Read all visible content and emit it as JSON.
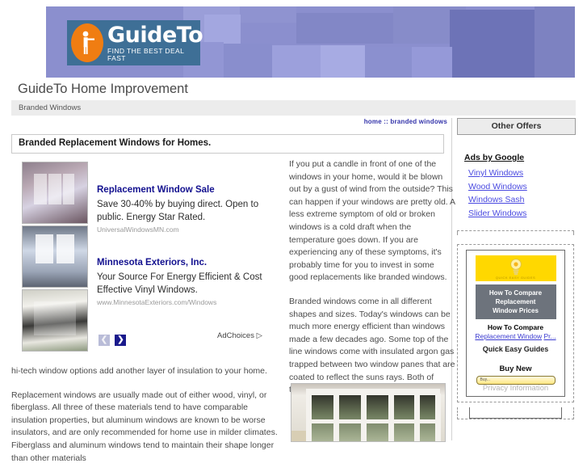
{
  "header": {
    "logo_name": "GuideTo",
    "logo_tagline": "FIND THE BEST DEAL FAST",
    "site_title": "GuideTo Home Improvement",
    "breadcrumb_bar": "Branded Windows",
    "top_nav": "home :: branded windows",
    "banner_color": "#8b8fce",
    "logo_box_color": "#3e6f96",
    "logo_circle_color": "#f07d12"
  },
  "main": {
    "page_title": "Branded Replacement Windows for Homes.",
    "ads": [
      {
        "title": "Replacement Window Sale",
        "description": "Save 30-40% by buying direct. Open to public. Energy Star Rated.",
        "url": "UniversalWindowsMN.com"
      },
      {
        "title": "Minnesota Exteriors, Inc.",
        "description": "Your Source For Energy Efficient & Cost Effective Vinyl Windows.",
        "url": "www.MinnesotaExteriors.com/Windows"
      }
    ],
    "ad_nav": {
      "prev": "❮",
      "next": "❯",
      "adchoices_label": "AdChoices"
    },
    "article_paragraphs": [
      "If you put a candle in front of one of the windows in your home, would it be blown out by a gust of wind from the outside? This can happen if your windows are pretty old. A less extreme symptom of old or broken windows is a cold draft when the temperature goes down. If you are experiencing any of these symptoms, it's probably time for you to invest in some good replacements like branded windows.",
      "Branded windows come in all different shapes and sizes. Today's windows can be much more energy efficient than windows made a few decades ago. Some top of the line windows come with insulated argon gas trapped between two window panes that are coated to reflect the suns rays. Both of these"
    ],
    "below_paragraphs": [
      "hi-tech window options add another layer of insulation to your home.",
      "Replacement windows are usually made out of either wood, vinyl, or fiberglass. All three of these materials tend to have comparable insulation properties, but aluminum windows are known to be worse insulators, and are only recommended for home use in milder climates. Fiberglass and aluminum windows tend to maintain their shape longer than other materials"
    ]
  },
  "sidebar": {
    "offers_button": "Other Offers",
    "ads_by_google": "Ads by Google",
    "ad_links": [
      "Vinyl Windows",
      "Wood Windows",
      "Windows Sash",
      "Slider Windows"
    ],
    "ad_unit": {
      "yellow_caption": "QUICK EASY GUIDES",
      "gray_lines": [
        "How To Compare",
        "Replacement",
        "Window Prices"
      ],
      "link_line1": "How To Compare",
      "link_line2": "Replacement Window",
      "link_line3": "Pr...",
      "advertiser": "Quick Easy Guides",
      "cta": "Buy New",
      "cta_bar_text": "Buy...",
      "privacy": "Privacy Information"
    },
    "link_color": "#4a4ae0"
  }
}
